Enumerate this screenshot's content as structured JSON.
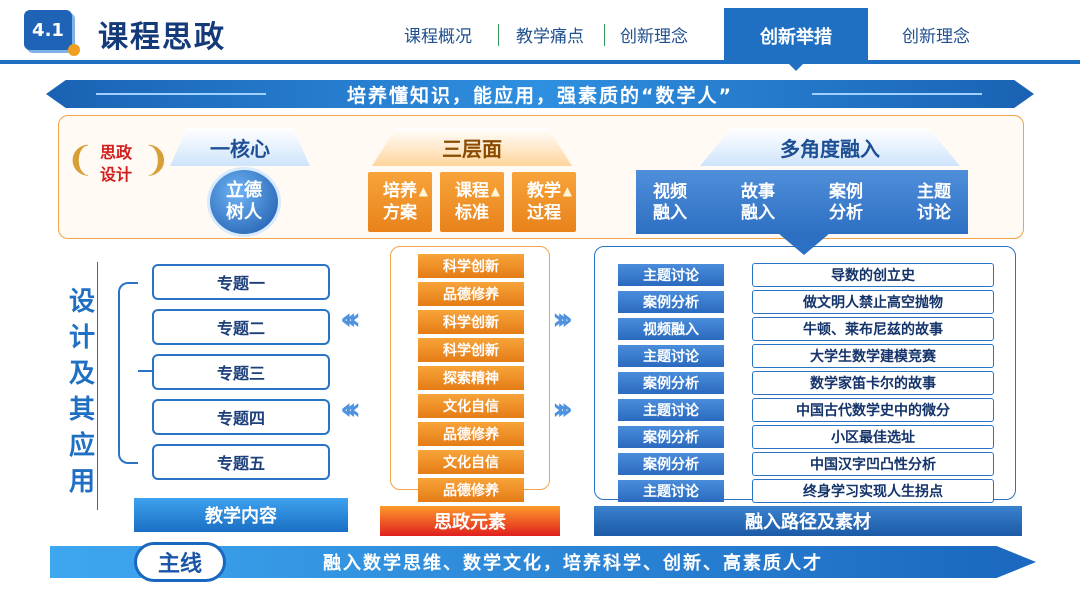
{
  "header": {
    "section_number": "4.1",
    "title": "课程思政",
    "tabs": [
      "课程概况",
      "教学痛点",
      "创新理念",
      "创新举措",
      "创新理念"
    ],
    "active_tab": "创新举措"
  },
  "banner": "培养懂知识，能应用，强素质的“数学人”",
  "top_panel": {
    "badge_line1": "思政",
    "badge_line2": "设计",
    "core_title": "一核心",
    "core_line1": "立德",
    "core_line2": "树人",
    "levels_title": "三层面",
    "levels": [
      {
        "l1": "培养",
        "l2": "方案"
      },
      {
        "l1": "课程",
        "l2": "标准"
      },
      {
        "l1": "教学",
        "l2": "过程"
      }
    ],
    "multi_title": "多角度融入",
    "multi": [
      {
        "l1": "视频",
        "l2": "融入"
      },
      {
        "l1": "故事",
        "l2": "融入"
      },
      {
        "l1": "案例",
        "l2": "分析"
      },
      {
        "l1": "主题",
        "l2": "讨论"
      }
    ]
  },
  "left": {
    "vertical_title": [
      "设",
      "计",
      "及",
      "其",
      "应",
      "用"
    ],
    "topics": [
      "专题一",
      "专题二",
      "专题三",
      "专题四",
      "专题五"
    ],
    "label": "教学内容"
  },
  "middle": {
    "elements": [
      "科学创新",
      "品德修养",
      "科学创新",
      "科学创新",
      "探索精神",
      "文化自信",
      "品德修养",
      "文化自信",
      "品德修养"
    ],
    "label": "思政元素"
  },
  "right": {
    "rows": [
      {
        "tag": "主题讨论",
        "material": "导数的创立史"
      },
      {
        "tag": "案例分析",
        "material": "做文明人禁止高空抛物"
      },
      {
        "tag": "视频融入",
        "material": "牛顿、莱布尼兹的故事"
      },
      {
        "tag": "主题讨论",
        "material": "大学生数学建模竞赛"
      },
      {
        "tag": "案例分析",
        "material": "数学家笛卡尔的故事"
      },
      {
        "tag": "主题讨论",
        "material": "中国古代数学史中的微分"
      },
      {
        "tag": "案例分析",
        "material": "小区最佳选址"
      },
      {
        "tag": "案例分析",
        "material": "中国汉字凹凸性分析"
      },
      {
        "tag": "主题讨论",
        "material": "终身学习实现人生拐点"
      }
    ],
    "label": "融入路径及素材"
  },
  "bottom": {
    "badge": "主线",
    "text": "融入数学思维、数学文化，培养科学、创新、高素质人才"
  }
}
